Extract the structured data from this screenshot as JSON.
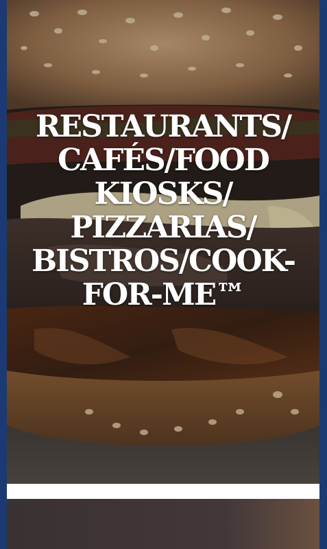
{
  "hero": {
    "image_alt": "burger-photo",
    "headline_lines": [
      "RESTAURANTS/",
      "CAFÉS/FOOD",
      "KIOSKS/",
      "PIZZARIAS/",
      "BISTROS/COOK-",
      "FOR-ME™"
    ]
  },
  "colors": {
    "frame_blue": "#1b3a73",
    "headline_text": "#ffffff",
    "divider": "#ffffff"
  }
}
